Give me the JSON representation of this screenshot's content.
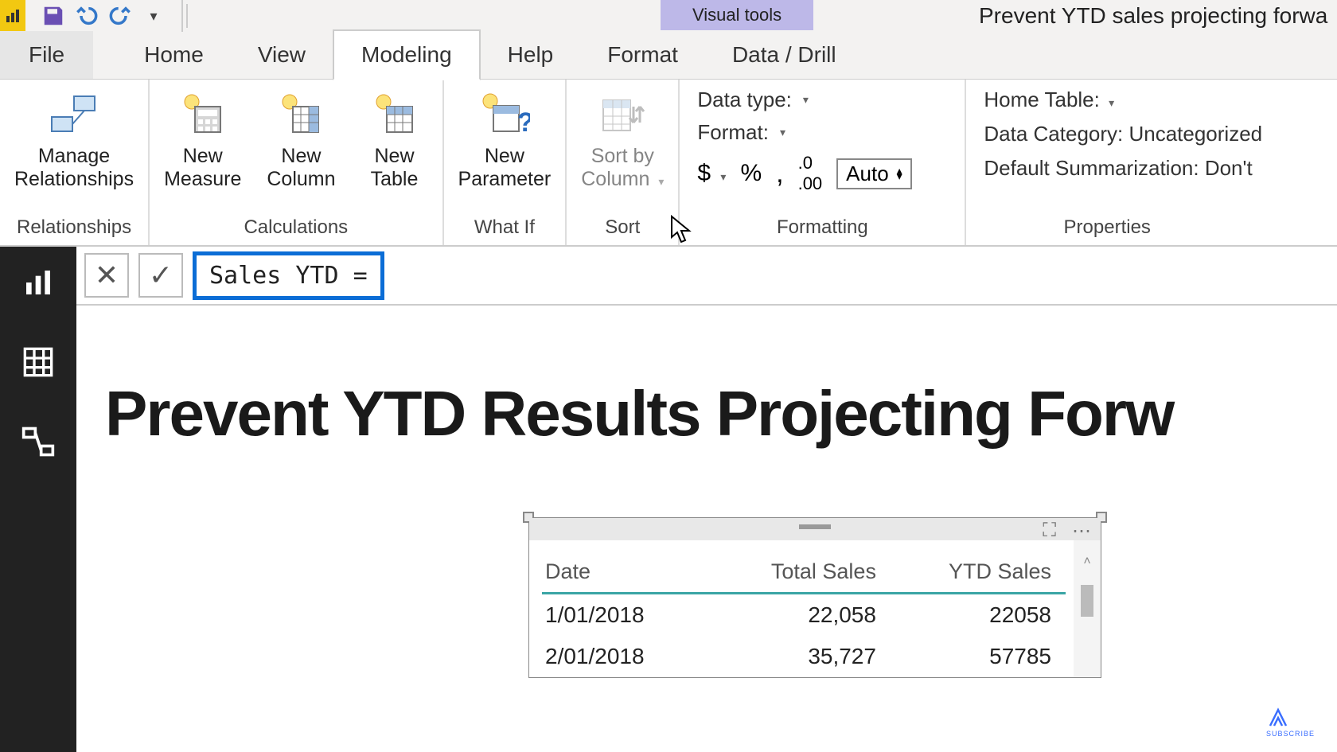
{
  "app": {
    "doc_title": "Prevent YTD sales projecting forwa"
  },
  "contextual_tab": "Visual tools",
  "tabs": {
    "file": "File",
    "home": "Home",
    "view": "View",
    "modeling": "Modeling",
    "help": "Help",
    "format": "Format",
    "data_drill": "Data / Drill"
  },
  "ribbon": {
    "relationships": {
      "manage": "Manage\nRelationships",
      "group": "Relationships"
    },
    "calculations": {
      "measure": "New\nMeasure",
      "column": "New\nColumn",
      "table": "New\nTable",
      "group": "Calculations"
    },
    "whatif": {
      "parameter": "New\nParameter",
      "group": "What If"
    },
    "sort": {
      "sortby": "Sort by\nColumn",
      "group": "Sort"
    },
    "formatting": {
      "data_type": "Data type:",
      "format": "Format:",
      "auto": "Auto",
      "group": "Formatting"
    },
    "properties": {
      "home_table": "Home Table:",
      "data_category": "Data Category: Uncategorized",
      "default_summ": "Default Summarization: Don't",
      "group": "Properties"
    }
  },
  "formula_bar": {
    "text": "Sales YTD ="
  },
  "report": {
    "title": "Prevent YTD Results Projecting Forw"
  },
  "table_visual": {
    "columns": [
      "Date",
      "Total Sales",
      "YTD Sales"
    ],
    "rows": [
      {
        "date": "1/01/2018",
        "total": "22,058",
        "ytd": "22058"
      },
      {
        "date": "2/01/2018",
        "total": "35,727",
        "ytd": "57785"
      }
    ]
  },
  "footer": {
    "subscribe": "SUBSCRIBE"
  }
}
